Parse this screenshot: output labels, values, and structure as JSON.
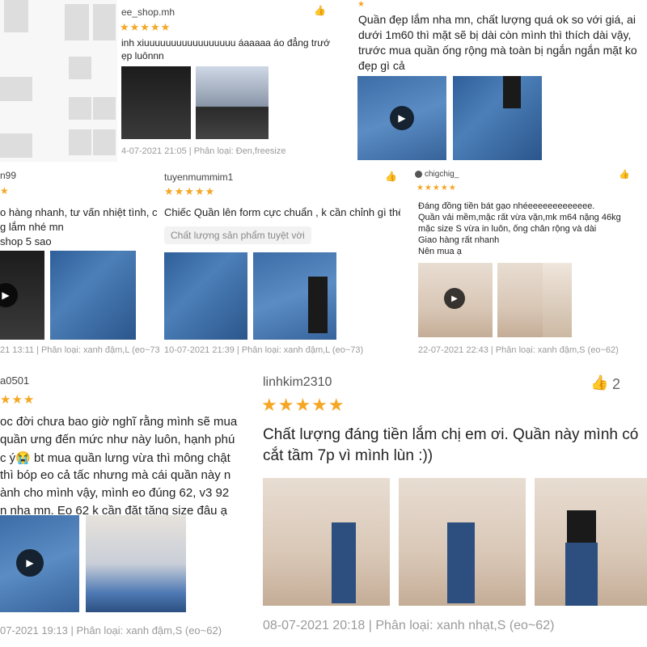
{
  "c1": {
    "user": "ee_shop.mh",
    "stars": "★★★★★",
    "lines": [
      "inh xiuuuuuuuuuuuuuuuuu áaaaaa áo đẳng trướ",
      "ẹp luônnn"
    ],
    "meta": "4-07-2021 21:05 | Phân loại: Đen,freesize"
  },
  "c2": {
    "lines": [
      "Quần đẹp lắm nha mn, chất lượng quá ok so với giá, ai",
      "dưới 1m60 thì mặt sẽ bị dài còn mình thì thích dài vậy,",
      "trước mua quần ống rộng mà toàn bị ngắn ngắn mặt ko",
      "đẹp gì cả"
    ]
  },
  "c3": {
    "user": "n99",
    "stars": "★",
    "lines": [
      "o hàng nhanh, tư vấn nhiệt tình, c",
      "g lắm nhé mn",
      "shop 5 sao"
    ],
    "meta": "21 13:11 | Phân loại: xanh đậm,L (eo~73"
  },
  "c4": {
    "user": "tuyenmummim1",
    "stars": "★★★★★",
    "line": "Chiếc Quần lên form cực chuẩn , k cần chỉnh gì thê",
    "chip": "Chất lượng sản phẩm tuyệt vời",
    "meta": "10-07-2021 21:39 | Phân loại: xanh đậm,L (eo~73)"
  },
  "c5": {
    "user": "chigchig_",
    "stars": "★★★★★",
    "lines": [
      "Đáng đồng tiền bát gạo nhéeeeeeeeeeeeee.",
      "Quần vải mềm,mặc rất vừa vặn,mk m64 nặng 46kg",
      "mặc size S vừa in luôn, ống chân rộng và dài",
      "Giao hàng rất nhanh",
      "Nên mua ạ"
    ],
    "meta": "22-07-2021 22:43 | Phân loại: xanh đậm,S (eo~62)"
  },
  "c6": {
    "user": "a0501",
    "stars": "★★★",
    "lines": [
      "oc đời chưa bao giờ nghĩ rằng mình sẽ mua",
      "quần ưng đến mức như này luôn, hạnh phú",
      "c ý😭 bt mua quần lưng vừa thì mông chật",
      "thì bóp eo cả tấc nhưng mà cái quần này n",
      "ành cho mình vậy, mình eo đúng 62, v3 92",
      "n nha mn. Eo 62 k cần đặt tăng size đâu ạ"
    ],
    "meta": "07-2021 19:13 | Phân loại: xanh đậm,S (eo~62)"
  },
  "c7": {
    "user": "linhkim2310",
    "stars": "★★★★★",
    "likes": "2",
    "lines": [
      "Chất lượng đáng tiền lắm chị em ơi. Quần này mình có",
      "cắt tầm 7p vì mình lùn :))"
    ],
    "meta": "08-07-2021 20:18 | Phân loại: xanh nhạt,S (eo~62)"
  },
  "icons": {
    "play": "▶",
    "thumb": "👍"
  },
  "colors": {
    "star": "#f5a623",
    "meta": "#9a9a9a"
  }
}
